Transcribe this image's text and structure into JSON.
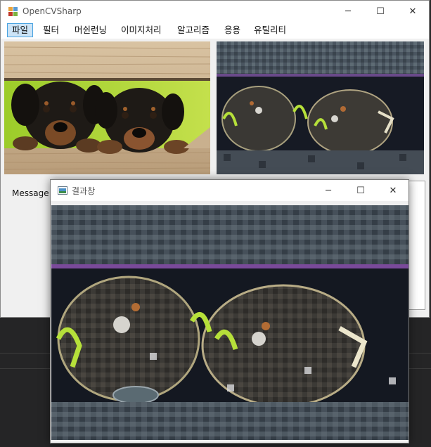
{
  "main_window": {
    "title": "OpenCVSharp",
    "controls": {
      "minimize": "─",
      "maximize": "☐",
      "close": "✕"
    }
  },
  "menu": [
    {
      "label": "파일",
      "active": true
    },
    {
      "label": "필터"
    },
    {
      "label": "머쉰런닝"
    },
    {
      "label": "이미지처리"
    },
    {
      "label": "알고리즘"
    },
    {
      "label": "응용"
    },
    {
      "label": "유틸리티"
    }
  ],
  "panes": {
    "original_image": "puppies-photo",
    "processed_image": "puppies-mosaic-filtered"
  },
  "message": {
    "label": "Message"
  },
  "result_window": {
    "title": "결과창",
    "controls": {
      "minimize": "─",
      "maximize": "☐",
      "close": "✕"
    },
    "image": "puppies-mosaic-filtered-large"
  },
  "colors": {
    "accent": "#4aa3e0",
    "menu_active_bg": "#cce4f7",
    "window_bg": "#f0f0f0"
  }
}
